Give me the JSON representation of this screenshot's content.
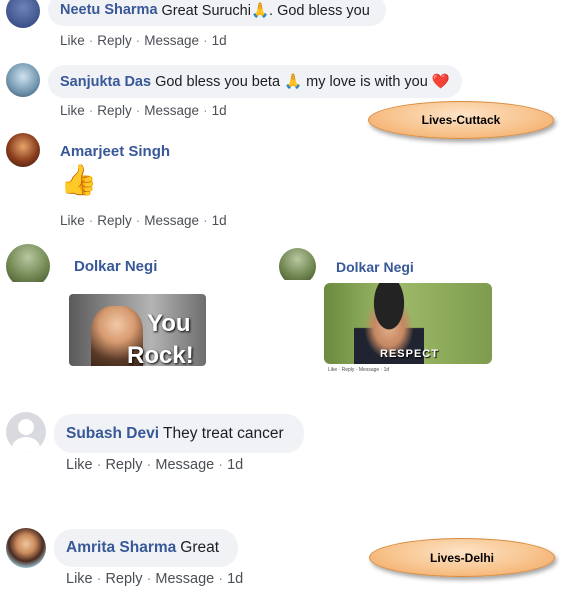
{
  "comments": [
    {
      "name": "Neetu Sharma",
      "text": "Great Suruchi🙏. God bless you",
      "actions": [
        "Like",
        "Reply",
        "Message",
        "1d"
      ]
    },
    {
      "name": "Sanjukta Das",
      "text": "God bless you beta 🙏 my love is with you ❤️",
      "actions": [
        "Like",
        "Reply",
        "Message",
        "1d"
      ]
    },
    {
      "name": "Amarjeet Singh",
      "text": "👍",
      "actions": [
        "Like",
        "Reply",
        "Message",
        "1d"
      ]
    },
    {
      "name": "Dolkar Negi",
      "gif_text": [
        "You",
        "Rock!"
      ]
    },
    {
      "name": "Dolkar Negi",
      "gif_text": [
        "RESPECT"
      ],
      "actions": [
        "Like",
        "Reply",
        "Message",
        "1d"
      ]
    },
    {
      "name": "Subash Devi",
      "text": "They treat cancer",
      "actions": [
        "Like",
        "Reply",
        "Message",
        "1d"
      ]
    },
    {
      "name": "Amrita Sharma",
      "text": "Great",
      "actions": [
        "Like",
        "Reply",
        "Message",
        "1d"
      ]
    }
  ],
  "labels": {
    "cuttack": "Lives-Cuttack",
    "delhi": "Lives-Delhi"
  },
  "colors": {
    "name_blue": "#385898",
    "bubble_bg": "#f0f2f5",
    "oval_orange": "#f8c48e"
  }
}
